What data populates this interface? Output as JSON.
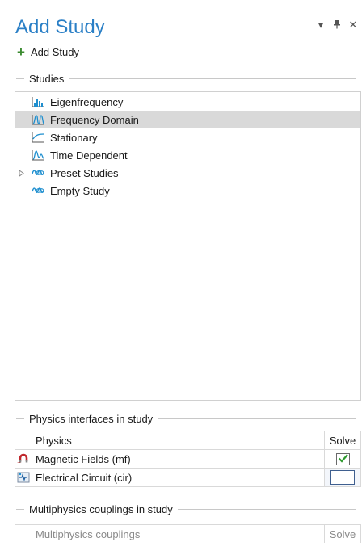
{
  "window": {
    "title": "Add Study",
    "controls": [
      {
        "name": "dropdown-icon",
        "glyph": "▾"
      },
      {
        "name": "pin-icon",
        "glyph": "⊣"
      },
      {
        "name": "close-icon",
        "glyph": "✕"
      }
    ]
  },
  "toolbar": {
    "add_study_label": "Add Study"
  },
  "studies": {
    "header": "Studies",
    "items": [
      {
        "label": "Eigenfrequency",
        "icon": "eigenfrequency-icon",
        "selected": false,
        "expandable": false
      },
      {
        "label": "Frequency Domain",
        "icon": "frequency-domain-icon",
        "selected": true,
        "expandable": false
      },
      {
        "label": "Stationary",
        "icon": "stationary-icon",
        "selected": false,
        "expandable": false
      },
      {
        "label": "Time Dependent",
        "icon": "time-dependent-icon",
        "selected": false,
        "expandable": false
      },
      {
        "label": "Preset Studies",
        "icon": "preset-studies-icon",
        "selected": false,
        "expandable": true
      },
      {
        "label": "Empty Study",
        "icon": "empty-study-icon",
        "selected": false,
        "expandable": false
      }
    ]
  },
  "physics": {
    "header": "Physics interfaces in study",
    "columns": {
      "physics": "Physics",
      "solve": "Solve"
    },
    "rows": [
      {
        "label": "Magnetic Fields (mf)",
        "icon": "magnetic-fields-icon",
        "solve": true
      },
      {
        "label": "Electrical Circuit (cir)",
        "icon": "electrical-circuit-icon",
        "solve": false
      }
    ]
  },
  "multiphysics": {
    "header": "Multiphysics couplings in study",
    "columns": {
      "couplings": "Multiphysics couplings",
      "solve": "Solve"
    }
  },
  "colors": {
    "title": "#2a7fc6",
    "selection": "#d9d9d9",
    "accent_icon": "#1f8fcf",
    "check_green": "#2f9a2f"
  }
}
